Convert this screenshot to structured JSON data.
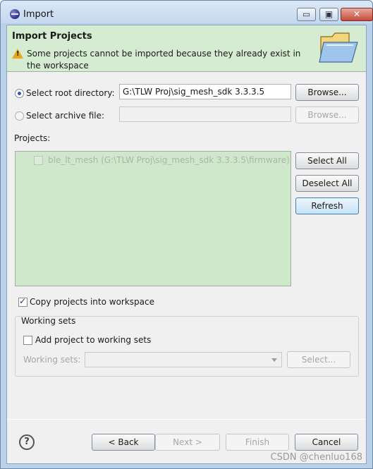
{
  "window": {
    "title": "Import",
    "minimize_glyph": "▭",
    "maximize_glyph": "▣",
    "close_glyph": "✕"
  },
  "header": {
    "title": "Import Projects",
    "message": "Some projects cannot be imported because they already exist in the workspace",
    "warning_icon": "warning-icon",
    "banner_icon": "folder-icon"
  },
  "source": {
    "root_label": "Select root directory:",
    "root_value": "G:\\TLW Proj\\sig_mesh_sdk 3.3.3.5",
    "root_selected": true,
    "archive_label": "Select archive file:",
    "archive_value": "",
    "browse_label": "Browse...",
    "browse_archive_label": "Browse..."
  },
  "projects": {
    "label": "Projects:",
    "items": [
      {
        "name": "ble_lt_mesh (G:\\TLW Proj\\sig_mesh_sdk 3.3.3.5\\firmware)",
        "checked": false
      }
    ],
    "select_all_label": "Select All",
    "deselect_all_label": "Deselect All",
    "refresh_label": "Refresh"
  },
  "options": {
    "copy_label": "Copy projects into workspace",
    "copy_checked": true
  },
  "working_sets": {
    "group_label": "Working sets",
    "add_label": "Add project to working sets",
    "add_checked": false,
    "sets_label": "Working sets:",
    "select_label": "Select..."
  },
  "footer": {
    "help_glyph": "?",
    "back_label": "< Back",
    "next_label": "Next >",
    "finish_label": "Finish",
    "cancel_label": "Cancel"
  },
  "watermark": "CSDN @chenluo168",
  "colors": {
    "header_bg": "#d6ecd2",
    "projects_bg": "#cfe7ca",
    "title_bar": "#c4d8ee",
    "warning": "#e8a814"
  }
}
